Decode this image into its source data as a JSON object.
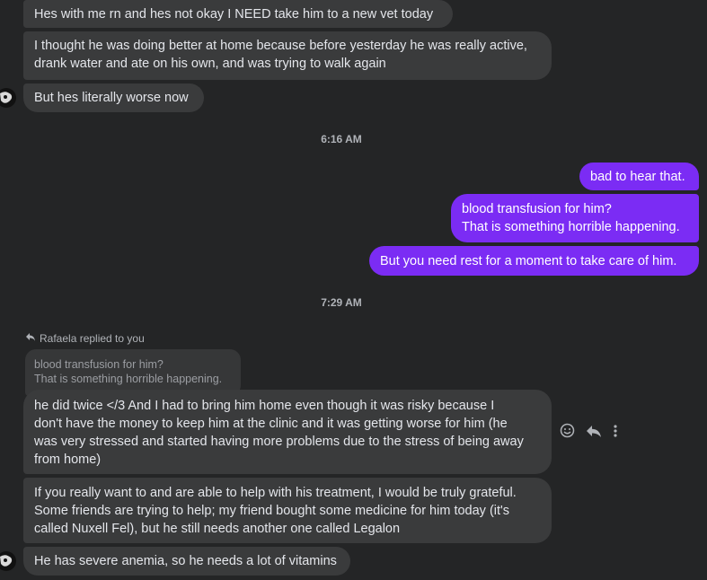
{
  "messages": {
    "m1": "Hes with me rn and hes not okay I NEED take him to a new vet today",
    "m2_l1": "I thought he was doing better at home because before yesterday he was really active,",
    "m2_l2": "drank water and ate on his own, and was trying to walk again",
    "m3": "But hes literally worse now",
    "ts1": "6:16 AM",
    "o1": "bad to hear that.",
    "o2_l1": "blood transfusion for him?",
    "o2_l2": "That is something horrible happening.",
    "o3": "But you need rest for a moment to take care of him.",
    "ts2": "7:29 AM",
    "reply_note": "Rafaela replied to you",
    "quote_l1": "blood transfusion for him?",
    "quote_l2": "That is something horrible happening.",
    "m4_l1": "he did twice </3 And I had to bring him home even though it was risky because I",
    "m4_l2": "don't have the money to keep him at the clinic and it was getting worse for him (he",
    "m4_l3": "was very stressed and started having more problems due to the stress of being away",
    "m4_l4": "from home)",
    "m5_l1": "If you really want to and are able to help with his treatment, I would be truly grateful.",
    "m5_l2": "Some friends are trying to help; my friend bought some medicine for him today (it's",
    "m5_l3": "called Nuxell Fel), but he still needs another one called Legalon",
    "m6": "He has severe anemia, so he needs a lot of vitamins"
  },
  "icons": [
    "reply-arrow-icon",
    "emoji-icon",
    "reply-icon",
    "more-options-icon"
  ],
  "colors": {
    "background": "#242526",
    "incoming": "#3a3b3c",
    "outgoing": "#7b2cf4"
  }
}
